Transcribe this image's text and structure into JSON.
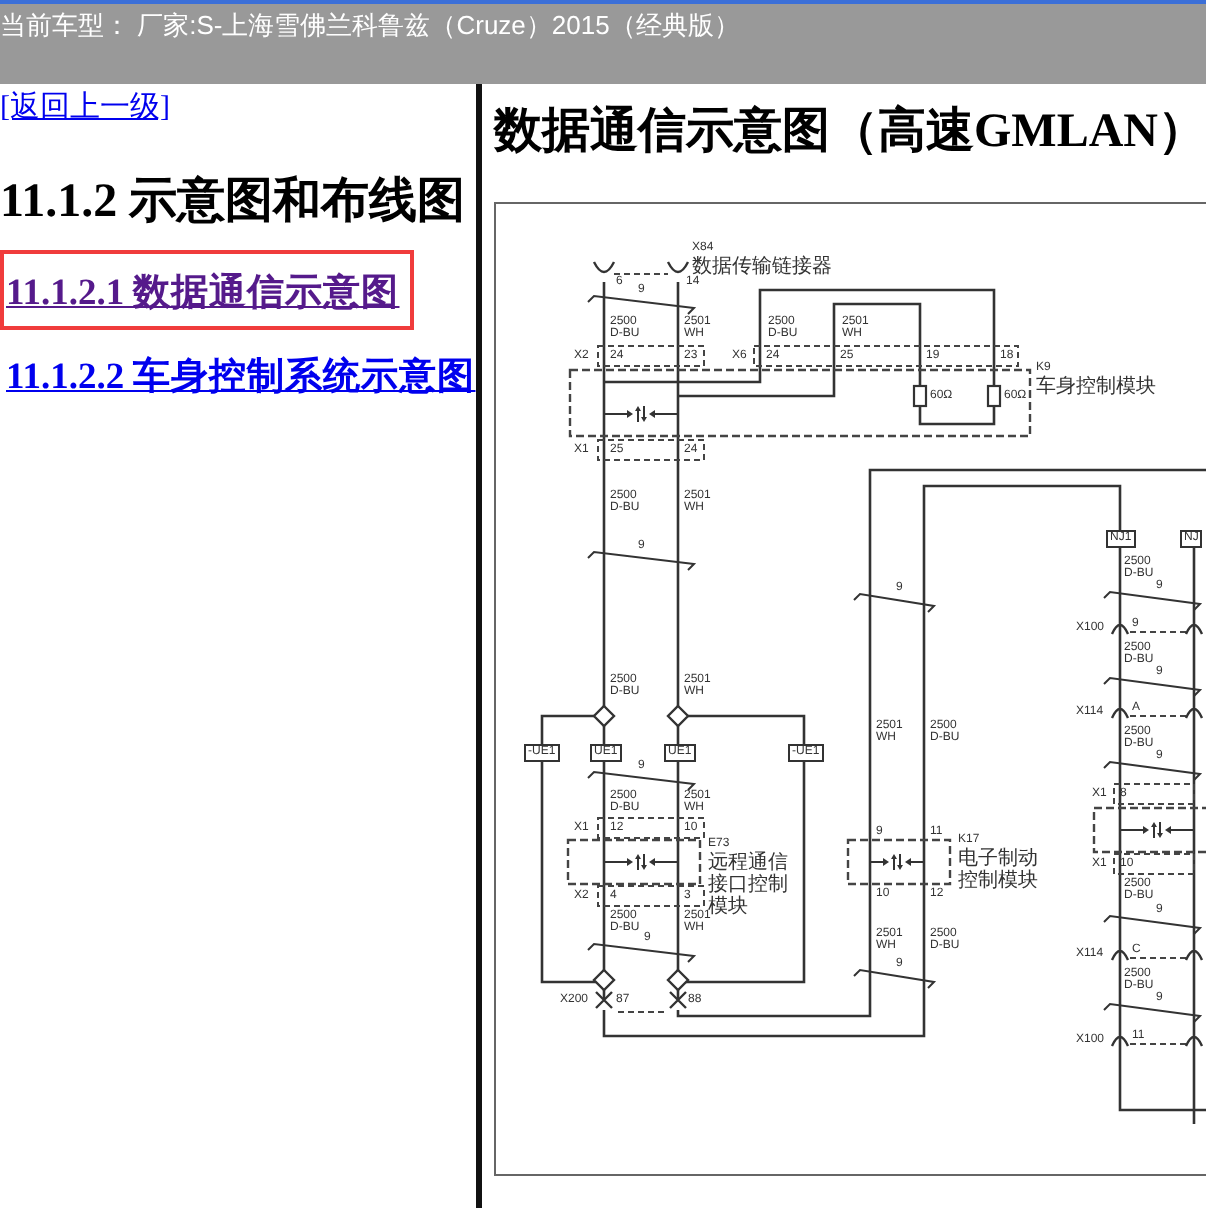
{
  "header": {
    "title": "当前车型： 厂家:S-上海雪佛兰科鲁兹（Cruze）2015（经典版）"
  },
  "sidebar": {
    "back_link": "[返回上一级]",
    "heading": "11.1.2 示意图和布线图",
    "items": [
      {
        "label": "11.1.2.1 数据通信示意图",
        "selected": true,
        "visited": true
      },
      {
        "label": "11.1.2.2 车身控制系统示意图",
        "selected": false,
        "visited": false
      }
    ]
  },
  "content": {
    "heading": "数据通信示意图（高速GMLAN）",
    "diagram": {
      "labels": [
        "X84",
        "数据传输链接器",
        "6",
        "14",
        "9",
        "2500 D-BU",
        "2501 WH",
        "2500 D-BU",
        "2501 WH",
        "X2",
        "24",
        "23",
        "X6",
        "24",
        "25",
        "19",
        "18",
        "K9",
        "车身控制模块",
        "60Ω",
        "60Ω",
        "X1",
        "25",
        "24",
        "2500 D-BU",
        "2501 WH",
        "9",
        "2500 D-BU",
        "2501 WH",
        "-UE1",
        "UE1",
        "UE1",
        "-UE1",
        "9",
        "2500 D-BU",
        "2501 WH",
        "X1",
        "12",
        "10",
        "E73",
        "远程通信接口控制模块",
        "X2",
        "4",
        "3",
        "2500 D-BU",
        "2501 WH",
        "9",
        "X200",
        "87",
        "88",
        "9",
        "2501 WH",
        "2500 D-BU",
        "9",
        "11",
        "K17",
        "电子制动控制模块",
        "10",
        "12",
        "2501 WH",
        "2500 D-BU",
        "9",
        "NJ1",
        "NJ",
        "2500 D-BU",
        "9",
        "X100",
        "9",
        "2500 D-BU",
        "9",
        "X114",
        "A",
        "2500 D-BU",
        "9",
        "X1",
        "8",
        "X1",
        "10",
        "2500 D-BU",
        "9",
        "X114",
        "C",
        "2500 D-BU",
        "9",
        "X100",
        "11"
      ]
    }
  }
}
